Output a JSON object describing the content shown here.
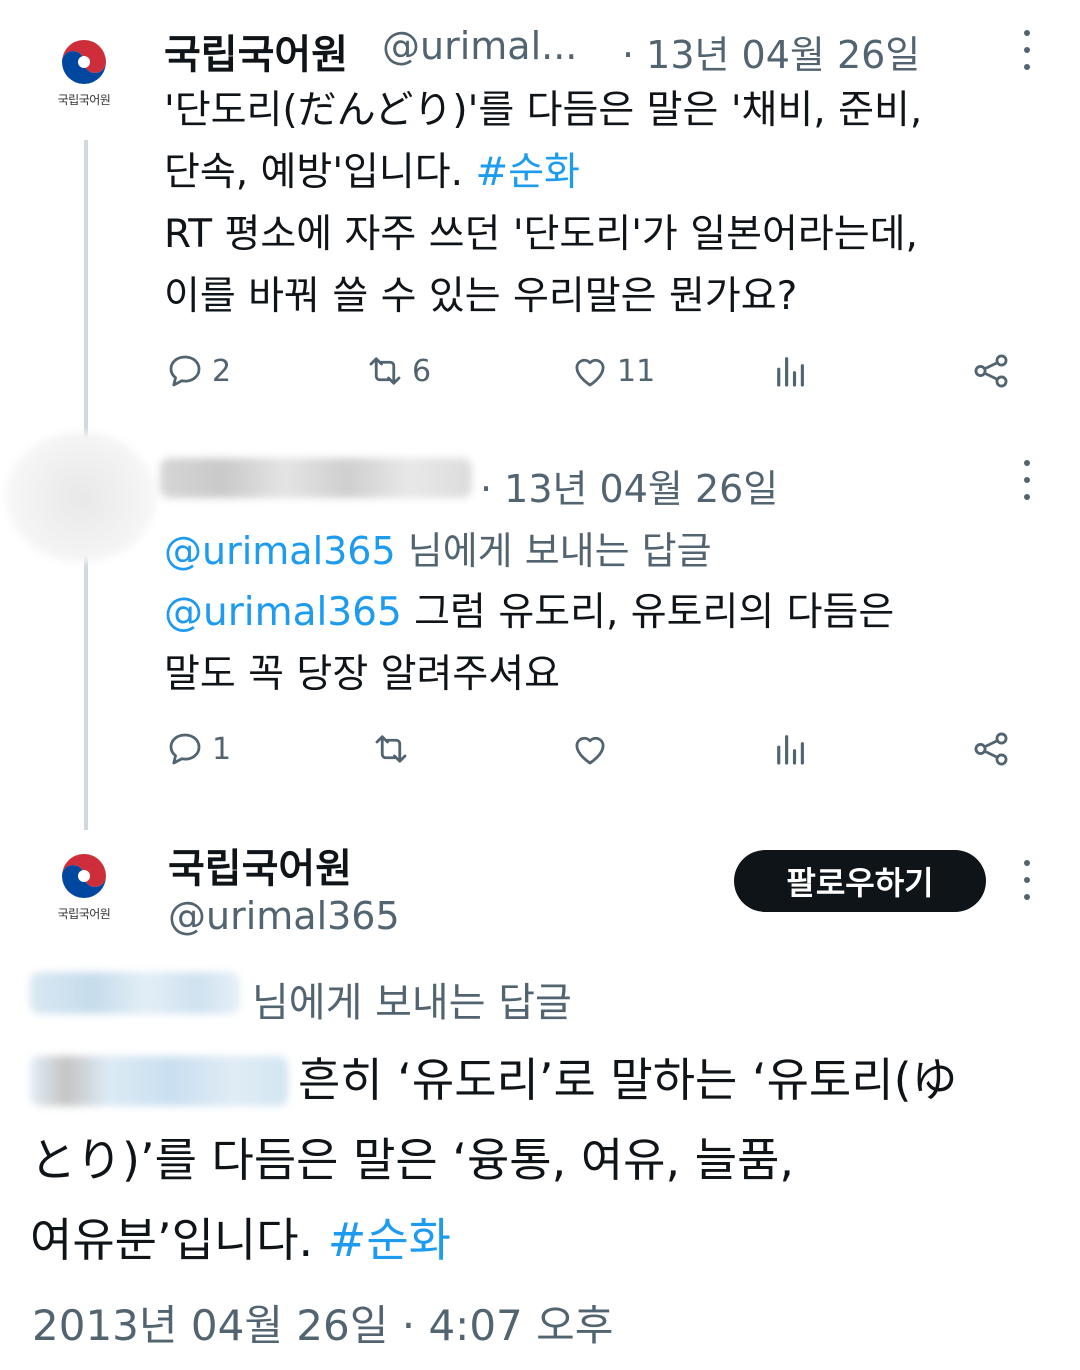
{
  "thread": {
    "tweet1": {
      "author_name": "국립국어원",
      "author_handle": "@urimal...",
      "date": "· 13년 04월 26일",
      "avatar_caption": "국립국어원",
      "body_line1": "'단도리(だんどり)'를 다듬은 말은 '채비, 준비,",
      "body_line2_text": "단속, 예방'입니다. ",
      "body_line2_hashtag": "#순화",
      "body_line3": "RT 평소에 자주 쓰던 '단도리'가 일본어라는데,",
      "body_line4": "이를 바꿔 쓸 수 있는 우리말은 뭔가요?",
      "reply_count": "2",
      "retweet_count": "6",
      "like_count": "11"
    },
    "tweet2": {
      "date": "· 13년 04월 26일",
      "reply_to_handle": "@urimal365",
      "reply_to_suffix": " 님에게 보내는 답글",
      "body_mention": "@urimal365",
      "body_line1_text": " 그럼 유도리, 유토리의 다듬은",
      "body_line2": "말도 꼭 당장 알려주셔요",
      "reply_count": "1"
    }
  },
  "main_tweet": {
    "author_name": "국립국어원",
    "author_handle": "@urimal365",
    "avatar_caption": "국립국어원",
    "follow_label": "팔로우하기",
    "reply_to_suffix": "님에게 보내는 답글",
    "body_line1_text": "흔히 ‘유도리’로 말하는 ‘유토리(ゆ",
    "body_line2": "とり)’를 다듬은 말은 ‘융통, 여유, 늘품,",
    "body_line3_text": "여유분’입니다. ",
    "body_line3_hashtag": "#순화",
    "timestamp": "2013년 04월 26일 · 4:07 오후"
  },
  "colors": {
    "link": "#1d9bf0",
    "muted": "#536471",
    "text": "#0f1419",
    "follow_button_bg": "#0f1419"
  },
  "icons": [
    "reply-icon",
    "retweet-icon",
    "like-icon",
    "views-icon",
    "share-icon",
    "more-icon"
  ]
}
